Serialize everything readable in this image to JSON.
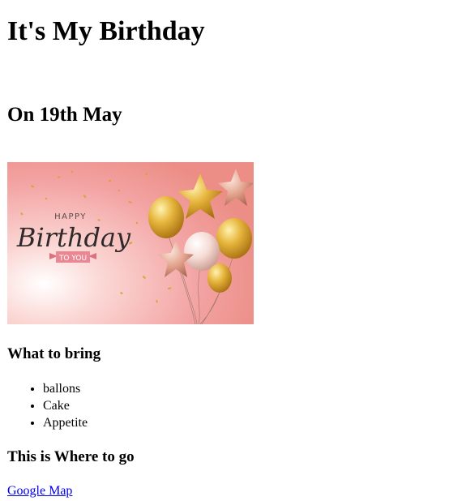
{
  "header": {
    "title": "It's My Birthday",
    "date": "On 19th May"
  },
  "banner": {
    "small_text": "HAPPY",
    "main_text": "Birthday",
    "ribbon_text": "TO YOU"
  },
  "bring": {
    "heading": "What to bring",
    "items": [
      "ballons",
      "Cake",
      "Appetite"
    ]
  },
  "location": {
    "heading": "This is Where to go",
    "link_label": "Google Map"
  },
  "colors": {
    "link": "#0000ee",
    "banner_pink": "#f4a7a8",
    "balloon_gold": "#e0b03a"
  }
}
